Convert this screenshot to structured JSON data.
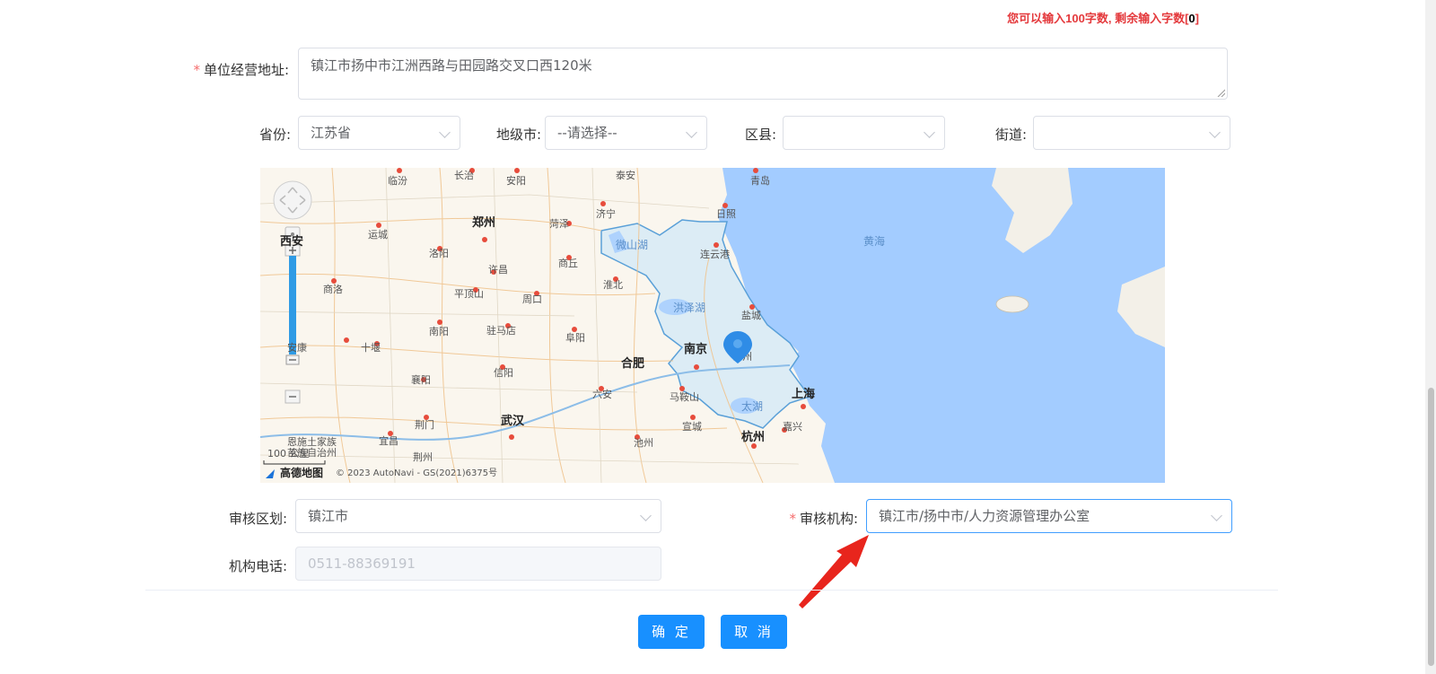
{
  "hint": {
    "prefix": "您可以输入100字数, 剩余输入字数[",
    "count": "0",
    "suffix": "]"
  },
  "form": {
    "address": {
      "label": "单位经营地址:",
      "value": "镇江市扬中市江洲西路与田园路交叉口西120米"
    },
    "province": {
      "label": "省份:",
      "value": "江苏省"
    },
    "city": {
      "label": "地级市:",
      "value": "--请选择--"
    },
    "district": {
      "label": "区县:",
      "value": ""
    },
    "street": {
      "label": "街道:",
      "value": ""
    },
    "review_area": {
      "label": "审核区划:",
      "value": "镇江市"
    },
    "review_org": {
      "label": "审核机构:",
      "value": "镇江市/扬中市/人力资源管理办公室"
    },
    "org_phone": {
      "label": "机构电话:",
      "value": "0511-88369191"
    }
  },
  "map": {
    "cities": [
      "临汾",
      "长治",
      "安阳",
      "泰安",
      "青岛",
      "日照",
      "郑州",
      "菏泽",
      "济宁",
      "运城",
      "洛阳",
      "商丘",
      "连云港",
      "许昌",
      "商洛",
      "平顶山",
      "周口",
      "淮北",
      "盐城",
      "南阳",
      "驻马店",
      "阜阳",
      "十堰",
      "襄阳",
      "信阳",
      "南京",
      "合肥",
      "泰州",
      "六安",
      "马鞍山",
      "上海",
      "荆门",
      "武汉",
      "宣城",
      "嘉兴",
      "宜昌",
      "池州",
      "杭州",
      "恩施土家族苗族自治州",
      "荆州",
      "西安",
      "安康"
    ],
    "waters": [
      "黄海",
      "微山湖",
      "洪泽湖",
      "太湖"
    ],
    "scale": "100 公里",
    "logo": "高德地图",
    "copyright": "© 2023 AutoNavi - GS(2021)6375号"
  },
  "buttons": {
    "confirm": "确 定",
    "cancel": "取 消"
  },
  "colors": {
    "primary": "#1890ff",
    "required": "#f56c6c",
    "hint": "#e4393c",
    "sea": "#a3ccff",
    "jiangsu_fill": "#dcecf5"
  }
}
